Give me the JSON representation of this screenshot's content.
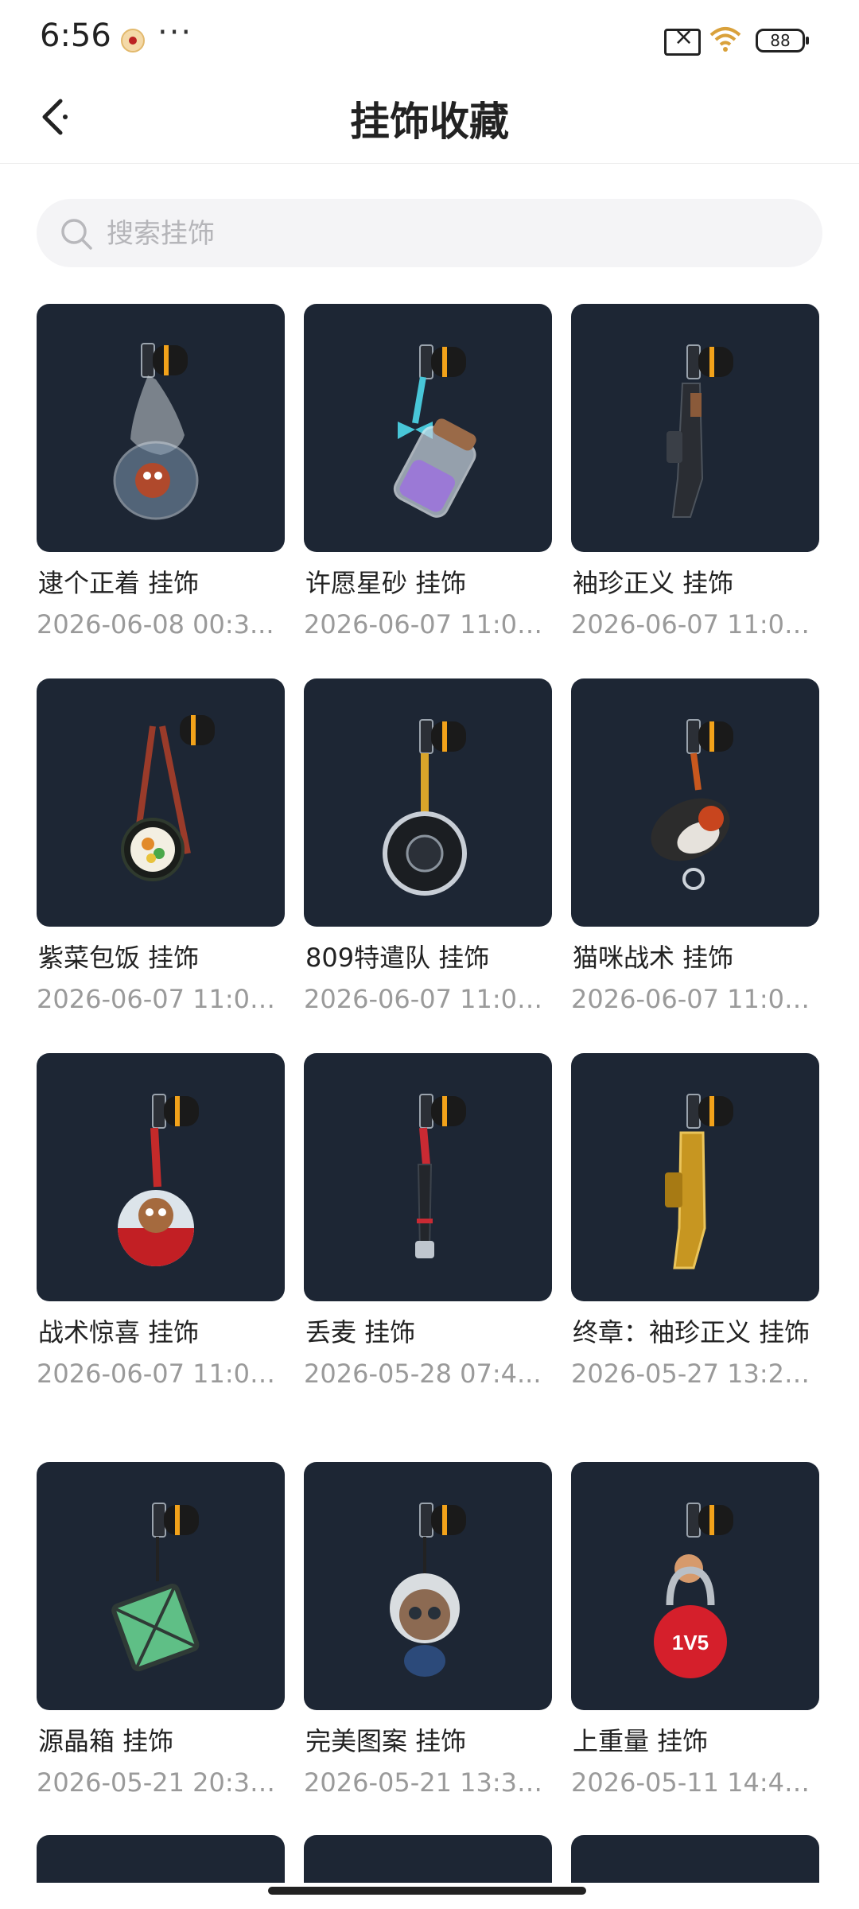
{
  "status_bar": {
    "time": "6:56",
    "more": "···",
    "battery": "88"
  },
  "header": {
    "title": "挂饰收藏"
  },
  "search": {
    "placeholder": "搜索挂饰",
    "value": ""
  },
  "items": [
    {
      "name": "逮个正着 挂饰",
      "date": "2026-06-08 00:3...",
      "charm": "net-bag-charm"
    },
    {
      "name": "许愿星砂 挂饰",
      "date": "2026-06-07 11:00...",
      "charm": "star-sand-bottle-charm"
    },
    {
      "name": "袖珍正义 挂饰",
      "date": "2026-06-07 11:00...",
      "charm": "mini-pistol-charm"
    },
    {
      "name": "紫菜包饭 挂饰",
      "date": "2026-06-07 11:00...",
      "charm": "kimbap-chopsticks-charm"
    },
    {
      "name": "809特遣队 挂饰",
      "date": "2026-06-07 11:00...",
      "charm": "frying-pan-charm"
    },
    {
      "name": "猫咪战术 挂饰",
      "date": "2026-06-07 11:00...",
      "charm": "cat-charm"
    },
    {
      "name": "战术惊喜 挂饰",
      "date": "2026-06-07 11:00...",
      "charm": "capsule-ball-charm"
    },
    {
      "name": "丢麦 挂饰",
      "date": "2026-05-28 07:4...",
      "charm": "microphone-charm"
    },
    {
      "name": "终章：袖珍正义 挂饰",
      "date": "2026-05-27 13:22...",
      "charm": "gold-pistol-charm"
    },
    {
      "name": "源晶箱 挂饰",
      "date": "2026-05-21 20:31...",
      "charm": "crystal-box-charm"
    },
    {
      "name": "完美图案 挂饰",
      "date": "2026-05-21 13:38...",
      "charm": "doll-charm"
    },
    {
      "name": "上重量 挂饰",
      "date": "2026-05-11 14:42...",
      "charm": "kettlebell-charm"
    }
  ],
  "kettlebell_text": "1V5",
  "colors": {
    "thumb_bg": "#1d2634",
    "date_gray": "#9a9a9a",
    "search_bg": "#f4f4f6"
  }
}
